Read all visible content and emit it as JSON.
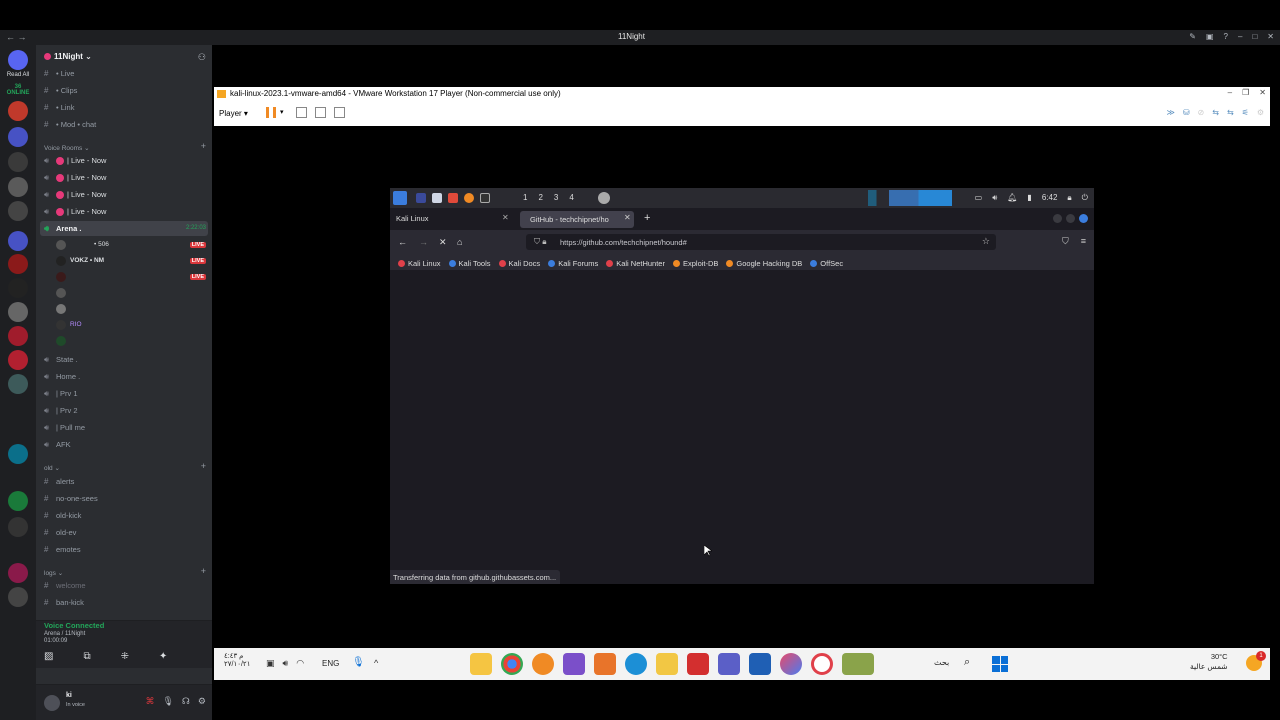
{
  "discord": {
    "titlebar": {
      "title": "11Night",
      "nav": "← →",
      "icons": [
        "pin-icon",
        "inbox-icon",
        "help-icon",
        "minimize-icon",
        "maximize-icon",
        "close-icon"
      ]
    },
    "rail": {
      "read_all": "Read All",
      "online": "36 ONLINE"
    },
    "server_name": "11Night",
    "channels_top": [
      {
        "icon": "#",
        "label": "• Live"
      },
      {
        "icon": "#",
        "label": "• Clips"
      },
      {
        "icon": "#",
        "label": "• Link"
      },
      {
        "icon": "#",
        "label": "• Mod • chat"
      }
    ],
    "category_voice": "Voice Rooms",
    "voice_live": [
      "| Live - Now",
      "| Live - Now",
      "| Live - Now",
      "| Live - Now"
    ],
    "arena": {
      "label": "Arena .",
      "time": "2:22:03"
    },
    "members": [
      {
        "name": "• 506",
        "live": "LIVE"
      },
      {
        "name": "VOKZ • NM",
        "live": "LIVE"
      },
      {
        "name": "",
        "live": "LIVE"
      },
      {
        "name": "",
        "live": ""
      },
      {
        "name": "",
        "live": ""
      },
      {
        "name": "RIO",
        "live": ""
      },
      {
        "name": "",
        "live": ""
      }
    ],
    "voice_channels": [
      {
        "label": "State ."
      },
      {
        "label": "Home ."
      },
      {
        "label": "| Prv 1"
      },
      {
        "label": "| Prv 2"
      },
      {
        "label": "| Pull me"
      },
      {
        "label": "AFK"
      }
    ],
    "category_old": "old",
    "old_channels": [
      "alerts",
      "no-one-sees",
      "old-kick",
      "old-ev",
      "emotes"
    ],
    "category_logs": "logs",
    "logs_channels": [
      "welcome",
      "ban-kick"
    ],
    "voice_panel": {
      "status": "Voice Connected",
      "channel": "Arena / 11Night",
      "time": "01:00:09"
    },
    "user": {
      "name": "ki",
      "status": "In voice"
    }
  },
  "vmware": {
    "title": "kali-linux-2023.1-vmware-amd64 - VMware Workstation 17 Player (Non-commercial use only)",
    "player_label": "Player"
  },
  "kali": {
    "workspaces": [
      "1",
      "2",
      "3",
      "4"
    ],
    "clock": "6:42",
    "tab1": "Kali Linux",
    "tab2": "GitHub - techchipnet/ho",
    "url": "https://github.com/techchipnet/hound#",
    "bookmarks": [
      {
        "label": "Kali Linux",
        "color": "#e0404a"
      },
      {
        "label": "Kali Tools",
        "color": "#3b7ddd"
      },
      {
        "label": "Kali Docs",
        "color": "#e0404a"
      },
      {
        "label": "Kali Forums",
        "color": "#3b7ddd"
      },
      {
        "label": "Kali NetHunter",
        "color": "#e0404a"
      },
      {
        "label": "Exploit-DB",
        "color": "#f08a24"
      },
      {
        "label": "Google Hacking DB",
        "color": "#f08a24"
      },
      {
        "label": "OffSec",
        "color": "#3b7ddd"
      }
    ],
    "status": "Transferring data from github.githubassets.com..."
  },
  "taskbar": {
    "time": "م ٤:٤٣",
    "date": "٢٧/١٠/٢١",
    "lang": "ENG",
    "search": "بحث",
    "temp": "30°C",
    "weather": "شمس عالية",
    "badge": "1"
  }
}
